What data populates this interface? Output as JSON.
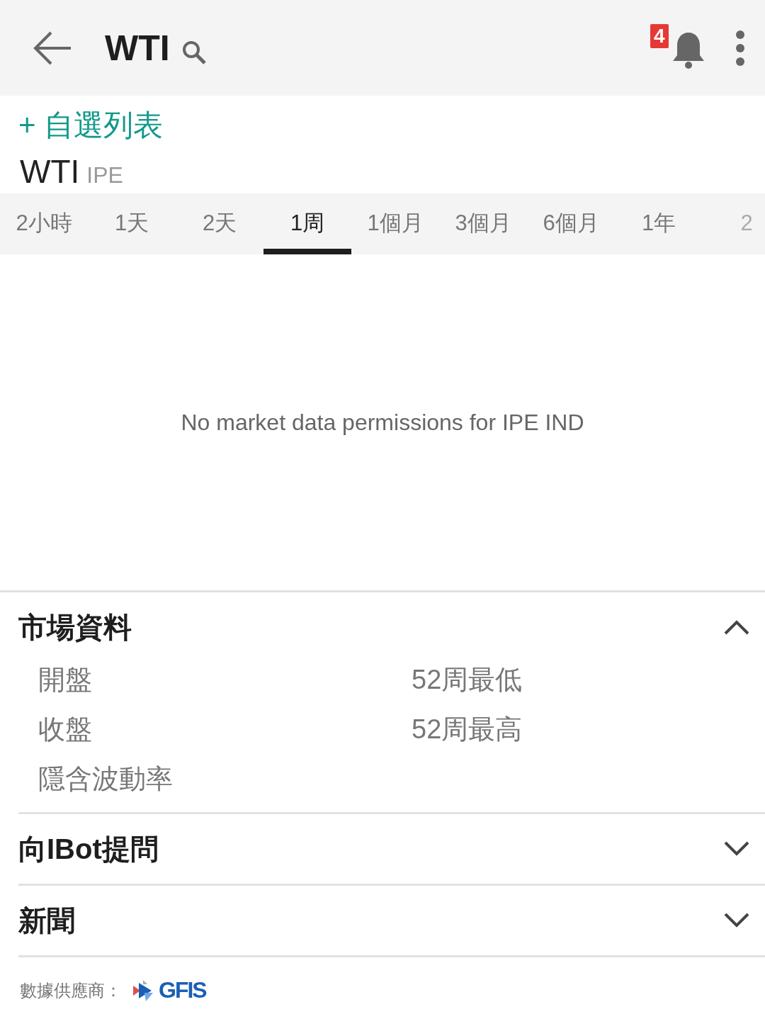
{
  "header": {
    "title": "WTI",
    "notification_count": "4"
  },
  "watchlist_button": "+ 自選列表",
  "symbol": {
    "name": "WTI",
    "exchange": "IPE"
  },
  "tabs": [
    {
      "label": "2小時",
      "selected": false
    },
    {
      "label": "1天",
      "selected": false
    },
    {
      "label": "2天",
      "selected": false
    },
    {
      "label": "1周",
      "selected": true
    },
    {
      "label": "1個月",
      "selected": false
    },
    {
      "label": "3個月",
      "selected": false
    },
    {
      "label": "6個月",
      "selected": false
    },
    {
      "label": "1年",
      "selected": false
    },
    {
      "label": "2",
      "selected": false
    }
  ],
  "chart_message": "No market data permissions for IPE IND",
  "sections": [
    {
      "title": "市場資料",
      "expanded": true,
      "fields": [
        "開盤",
        "52周最低",
        "收盤",
        "52周最高",
        "隱含波動率"
      ]
    },
    {
      "title": "向IBot提問",
      "expanded": false
    },
    {
      "title": "新聞",
      "expanded": false
    }
  ],
  "footer": {
    "label": "數據供應商：",
    "logo_text": "GFIS"
  }
}
